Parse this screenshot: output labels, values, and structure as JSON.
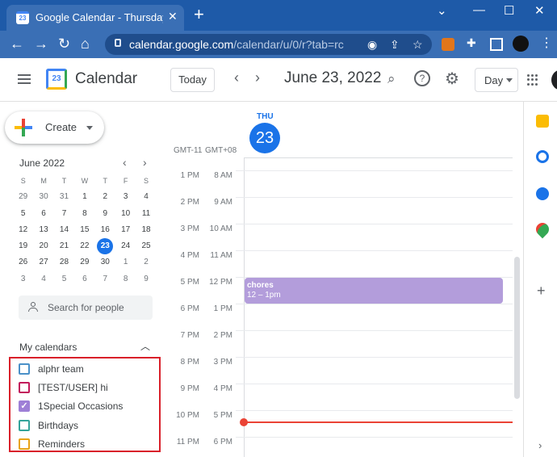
{
  "browser": {
    "tab_title": "Google Calendar - Thursday, June",
    "favicon_text": "23",
    "close": "✕",
    "new_tab": "+",
    "url_host": "calendar.google.com",
    "url_path": "/calendar/u/0/r?tab=rc",
    "win_min": "⌄",
    "win_minimize": "—",
    "win_max": "☐",
    "win_close": "✕"
  },
  "header": {
    "app_name": "Calendar",
    "logo_text": "23",
    "today_label": "Today",
    "prev": "‹",
    "next": "›",
    "date_title": "June 23, 2022",
    "view_label": "Day"
  },
  "sidebar": {
    "create_label": "Create",
    "mini_cal": {
      "title": "June 2022",
      "prev": "‹",
      "next": "›",
      "weekdays": [
        "S",
        "M",
        "T",
        "W",
        "T",
        "F",
        "S"
      ],
      "weeks": [
        [
          "29",
          "30",
          "31",
          "1",
          "2",
          "3",
          "4"
        ],
        [
          "5",
          "6",
          "7",
          "8",
          "9",
          "10",
          "11"
        ],
        [
          "12",
          "13",
          "14",
          "15",
          "16",
          "17",
          "18"
        ],
        [
          "19",
          "20",
          "21",
          "22",
          "23",
          "24",
          "25"
        ],
        [
          "26",
          "27",
          "28",
          "29",
          "30",
          "1",
          "2"
        ],
        [
          "3",
          "4",
          "5",
          "6",
          "7",
          "8",
          "9"
        ]
      ],
      "selected": "23"
    },
    "search_people_placeholder": "Search for people",
    "my_calendars_title": "My calendars",
    "calendars": [
      {
        "label": "alphr team",
        "color": "#4a90c8",
        "checked": false
      },
      {
        "label": "[TEST/USER] hi",
        "color": "#c2185b",
        "checked": false
      },
      {
        "label": "1Special Occasions",
        "color": "#9e7fd6",
        "checked": true
      },
      {
        "label": "Birthdays",
        "color": "#33a39a",
        "checked": false
      },
      {
        "label": "Reminders",
        "color": "#e8a317",
        "checked": false
      }
    ]
  },
  "day_view": {
    "weekday": "THU",
    "day_number": "23",
    "tz_primary": "GMT-11",
    "tz_secondary": "GMT+08",
    "hours": [
      {
        "primary": "1 PM",
        "secondary": "8 AM"
      },
      {
        "primary": "2 PM",
        "secondary": "9 AM"
      },
      {
        "primary": "3 PM",
        "secondary": "10 AM"
      },
      {
        "primary": "4 PM",
        "secondary": "11 AM"
      },
      {
        "primary": "5 PM",
        "secondary": "12 PM"
      },
      {
        "primary": "6 PM",
        "secondary": "1 PM"
      },
      {
        "primary": "7 PM",
        "secondary": "2 PM"
      },
      {
        "primary": "8 PM",
        "secondary": "3 PM"
      },
      {
        "primary": "9 PM",
        "secondary": "4 PM"
      },
      {
        "primary": "10 PM",
        "secondary": "5 PM"
      },
      {
        "primary": "11 PM",
        "secondary": "6 PM"
      }
    ],
    "event": {
      "title": "chores",
      "time": "12 – 1pm",
      "color": "#b39ddb"
    }
  },
  "colors": {
    "accent": "#1a73e8",
    "browser_bar": "#1e5aa8",
    "now_line": "#ea4335",
    "highlight_box": "#d9202a"
  }
}
